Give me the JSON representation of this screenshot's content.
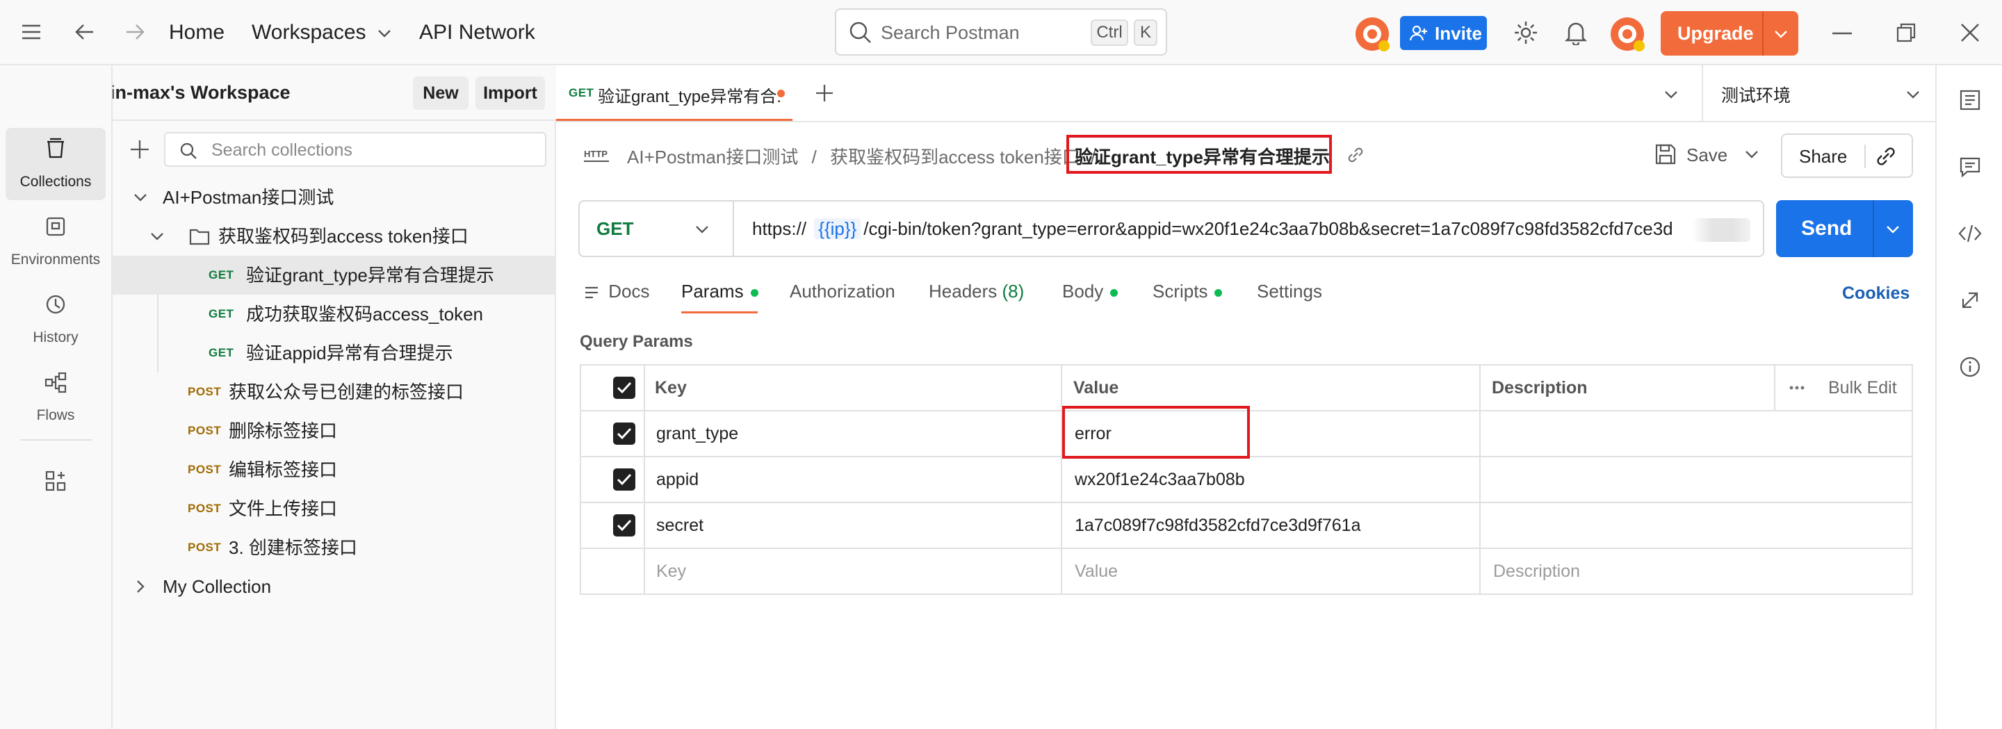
{
  "topbar": {
    "home": "Home",
    "workspaces": "Workspaces",
    "api_network": "API Network",
    "search_placeholder": "Search Postman",
    "kbd_ctrl": "Ctrl",
    "kbd_k": "K",
    "invite": "Invite",
    "upgrade": "Upgrade"
  },
  "workspace": {
    "name": "Jianglin-max's Workspace",
    "new_label": "New",
    "import_label": "Import"
  },
  "rail": [
    {
      "label": "Collections",
      "icon": "collections-icon"
    },
    {
      "label": "Environments",
      "icon": "environments-icon"
    },
    {
      "label": "History",
      "icon": "history-icon"
    },
    {
      "label": "Flows",
      "icon": "flows-icon"
    }
  ],
  "sidebar": {
    "search_placeholder": "Search collections",
    "tree": [
      {
        "label": "AI+Postman接口测试",
        "type": "collection"
      },
      {
        "label": "获取鉴权码到access token接口",
        "type": "folder"
      },
      {
        "label": "验证grant_type异常有合理提示",
        "method": "GET"
      },
      {
        "label": "成功获取鉴权码access_token",
        "method": "GET"
      },
      {
        "label": "验证appid异常有合理提示",
        "method": "GET"
      },
      {
        "label": "获取公众号已创建的标签接口",
        "method": "POST"
      },
      {
        "label": "删除标签接口",
        "method": "POST"
      },
      {
        "label": "编辑标签接口",
        "method": "POST"
      },
      {
        "label": "文件上传接口",
        "method": "POST"
      },
      {
        "label": "3. 创建标签接口",
        "method": "POST"
      },
      {
        "label": "My Collection",
        "type": "collection"
      }
    ]
  },
  "tab": {
    "method": "GET",
    "title": "验证grant_type异常有合:",
    "environment": "测试环境"
  },
  "breadcrumb": {
    "collection": "AI+Postman接口测试",
    "folder": "获取鉴权码到access token接口",
    "request": "验证grant_type异常有合理提示",
    "save": "Save",
    "share": "Share"
  },
  "request": {
    "method": "GET",
    "url_prefix": "https://",
    "url_var": "{{ip}}",
    "url_rest": "/cgi-bin/token?grant_type=error&appid=wx20f1e24c3aa7b08b&secret=1a7c089f7c98fd3582cfd7ce3d",
    "send": "Send"
  },
  "subtabs": {
    "docs": "Docs",
    "params": "Params",
    "authorization": "Authorization",
    "headers": "Headers",
    "headers_count": "(8)",
    "body": "Body",
    "scripts": "Scripts",
    "settings": "Settings",
    "cookies": "Cookies"
  },
  "params": {
    "section_title": "Query Params",
    "columns": {
      "key": "Key",
      "value": "Value",
      "description": "Description",
      "bulk_edit": "Bulk Edit"
    },
    "rows": [
      {
        "key": "grant_type",
        "value": "error",
        "description": ""
      },
      {
        "key": "appid",
        "value": "wx20f1e24c3aa7b08b",
        "description": ""
      },
      {
        "key": "secret",
        "value": "1a7c089f7c98fd3582cfd7ce3d9f761a",
        "description": ""
      }
    ],
    "placeholders": {
      "key": "Key",
      "value": "Value",
      "description": "Description"
    }
  },
  "colors": {
    "accent_blue": "#1a73e8",
    "upgrade_orange": "#f26b3a",
    "get_green": "#0f7b3e",
    "post_amber": "#a06a00",
    "highlight_red": "#e0191f"
  }
}
